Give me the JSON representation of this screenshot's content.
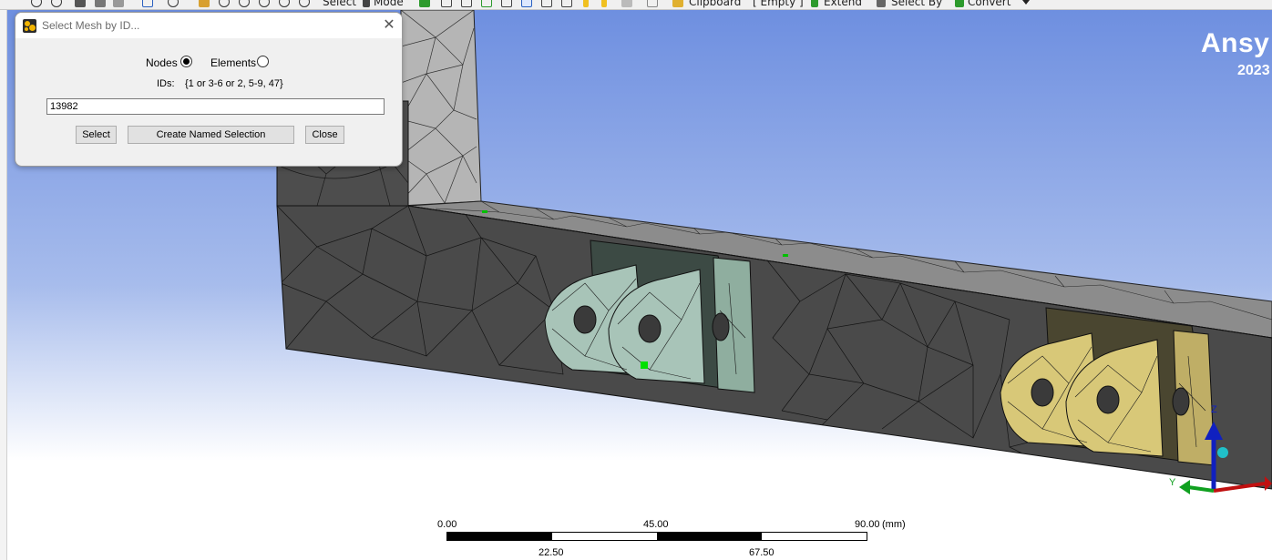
{
  "toolbar": {
    "items": [
      {
        "label": "Select",
        "icon": "select-icon"
      },
      {
        "label": "Mode",
        "icon": "mode-icon"
      },
      {
        "label": "Clipboard",
        "icon": "clipboard-icon"
      },
      {
        "label": "[ Empty ]",
        "icon": ""
      },
      {
        "label": "Extend",
        "icon": "extend-icon"
      },
      {
        "label": "Select By",
        "icon": "select-by-icon"
      },
      {
        "label": "Convert",
        "icon": "convert-icon"
      }
    ]
  },
  "dialog": {
    "title": "Select Mesh by ID...",
    "icon": "ansys-mesh-icon",
    "close_glyph": "✕",
    "mode_options": [
      {
        "label": "Nodes",
        "selected": true
      },
      {
        "label": "Elements",
        "selected": false
      }
    ],
    "ids_label": "IDs:",
    "ids_hint": "{1 or 3-6 or 2, 5-9, 47}",
    "ids_value": "13982",
    "buttons": {
      "select": "Select",
      "create_named_selection": "Create Named Selection",
      "close": "Close"
    }
  },
  "viewport": {
    "brand": "Ansy",
    "version": "2023",
    "triad": {
      "y_label": "Y",
      "z_label": "Z"
    },
    "colors": {
      "mesh_body": "#4c4c4c",
      "mesh_wall": "#b3b3b3",
      "part_green": "#a8c4b8",
      "part_yellow": "#d8c878",
      "selected_node": "#00e000"
    }
  },
  "scale_bar": {
    "unit": "(mm)",
    "top_ticks": [
      "0.00",
      "45.00",
      "90.00"
    ],
    "bottom_ticks": [
      "22.50",
      "67.50"
    ]
  }
}
